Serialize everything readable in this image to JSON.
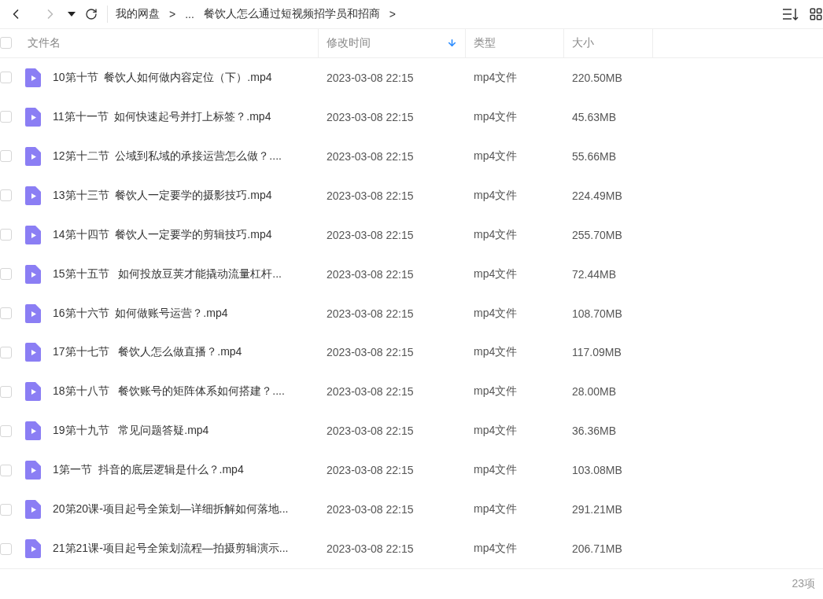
{
  "toolbar": {
    "breadcrumb": [
      {
        "label": "我的网盘",
        "separator": ">"
      },
      {
        "label": "..."
      },
      {
        "label": "餐饮人怎么通过短视频招学员和招商",
        "separator": ">"
      }
    ]
  },
  "table": {
    "header_checked": false,
    "columns": [
      {
        "label": "文件名",
        "sorted": false
      },
      {
        "label": "修改时间",
        "sorted": true
      },
      {
        "label": "类型",
        "sorted": false
      },
      {
        "label": "大小",
        "sorted": false
      }
    ],
    "rows": [
      {
        "name": "10第十节  餐饮人如何做内容定位（下）.mp4",
        "modified": "2023-03-08 22:15",
        "type": "mp4文件",
        "size": "220.50MB",
        "checked": false
      },
      {
        "name": "11第十一节  如何快速起号并打上标签？.mp4",
        "modified": "2023-03-08 22:15",
        "type": "mp4文件",
        "size": "45.63MB",
        "checked": false
      },
      {
        "name": "12第十二节  公域到私域的承接运营怎么做？....",
        "modified": "2023-03-08 22:15",
        "type": "mp4文件",
        "size": "55.66MB",
        "checked": false
      },
      {
        "name": "13第十三节  餐饮人一定要学的摄影技巧.mp4",
        "modified": "2023-03-08 22:15",
        "type": "mp4文件",
        "size": "224.49MB",
        "checked": false
      },
      {
        "name": "14第十四节  餐饮人一定要学的剪辑技巧.mp4",
        "modified": "2023-03-08 22:15",
        "type": "mp4文件",
        "size": "255.70MB",
        "checked": false
      },
      {
        "name": "15第十五节   如何投放豆荚才能撬动流量杠杆...",
        "modified": "2023-03-08 22:15",
        "type": "mp4文件",
        "size": "72.44MB",
        "checked": false
      },
      {
        "name": "16第十六节  如何做账号运营？.mp4",
        "modified": "2023-03-08 22:15",
        "type": "mp4文件",
        "size": "108.70MB",
        "checked": false
      },
      {
        "name": "17第十七节   餐饮人怎么做直播？.mp4",
        "modified": "2023-03-08 22:15",
        "type": "mp4文件",
        "size": "117.09MB",
        "checked": false
      },
      {
        "name": "18第十八节   餐饮账号的矩阵体系如何搭建？....",
        "modified": "2023-03-08 22:15",
        "type": "mp4文件",
        "size": "28.00MB",
        "checked": false
      },
      {
        "name": "19第十九节   常见问题答疑.mp4",
        "modified": "2023-03-08 22:15",
        "type": "mp4文件",
        "size": "36.36MB",
        "checked": false
      },
      {
        "name": "1第一节  抖音的底层逻辑是什么？.mp4",
        "modified": "2023-03-08 22:15",
        "type": "mp4文件",
        "size": "103.08MB",
        "checked": false
      },
      {
        "name": "20第20课-项目起号全策划—详细拆解如何落地...",
        "modified": "2023-03-08 22:15",
        "type": "mp4文件",
        "size": "291.21MB",
        "checked": false
      },
      {
        "name": "21第21课-项目起号全策划流程—拍摄剪辑演示...",
        "modified": "2023-03-08 22:15",
        "type": "mp4文件",
        "size": "206.71MB",
        "checked": false
      }
    ]
  },
  "status_bar": {
    "count": "23项"
  }
}
